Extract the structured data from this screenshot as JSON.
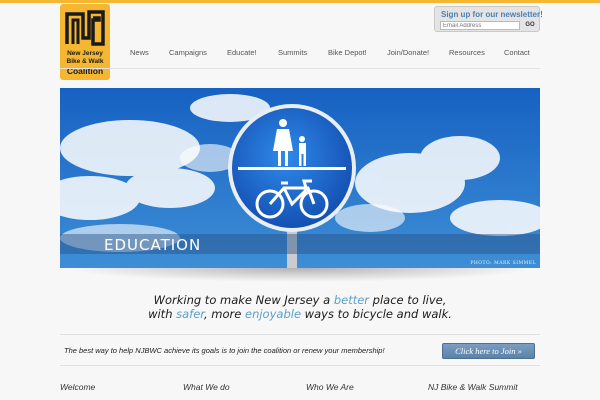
{
  "logo": {
    "line1": "New Jersey",
    "line2": "Bike & Walk",
    "line3": "Coalition"
  },
  "newsletter": {
    "title": "Sign up for our newsletter!",
    "placeholder": "Email Address",
    "go_label": "GO"
  },
  "nav": {
    "items": [
      "News",
      "Campaigns",
      "Educate!",
      "Summits",
      "Bike Depot!",
      "Join/Donate!",
      "Resources",
      "Contact"
    ]
  },
  "hero": {
    "title": "EDUCATION",
    "credit": "PHOTO: MARK SIMMEL"
  },
  "tagline": {
    "l1_a": "Working to make New Jersey a ",
    "l1_b": "better",
    "l1_c": " place to live,",
    "l2_a": "with ",
    "l2_b": "safer",
    "l2_c": ", more ",
    "l2_d": "enjoyable",
    "l2_e": " ways to bicycle and walk."
  },
  "join": {
    "text": "The best way to help NJBWC achieve its goals is to join the coalition or renew your membership!",
    "button": "Click here to Join »"
  },
  "footer": {
    "links": [
      "Welcome",
      "What We do",
      "Who We Are",
      "NJ Bike & Walk Summit"
    ]
  },
  "colors": {
    "accent": "#f5b731",
    "link_blue": "#5aa0cc",
    "sign_blue": "#1e63c6"
  }
}
